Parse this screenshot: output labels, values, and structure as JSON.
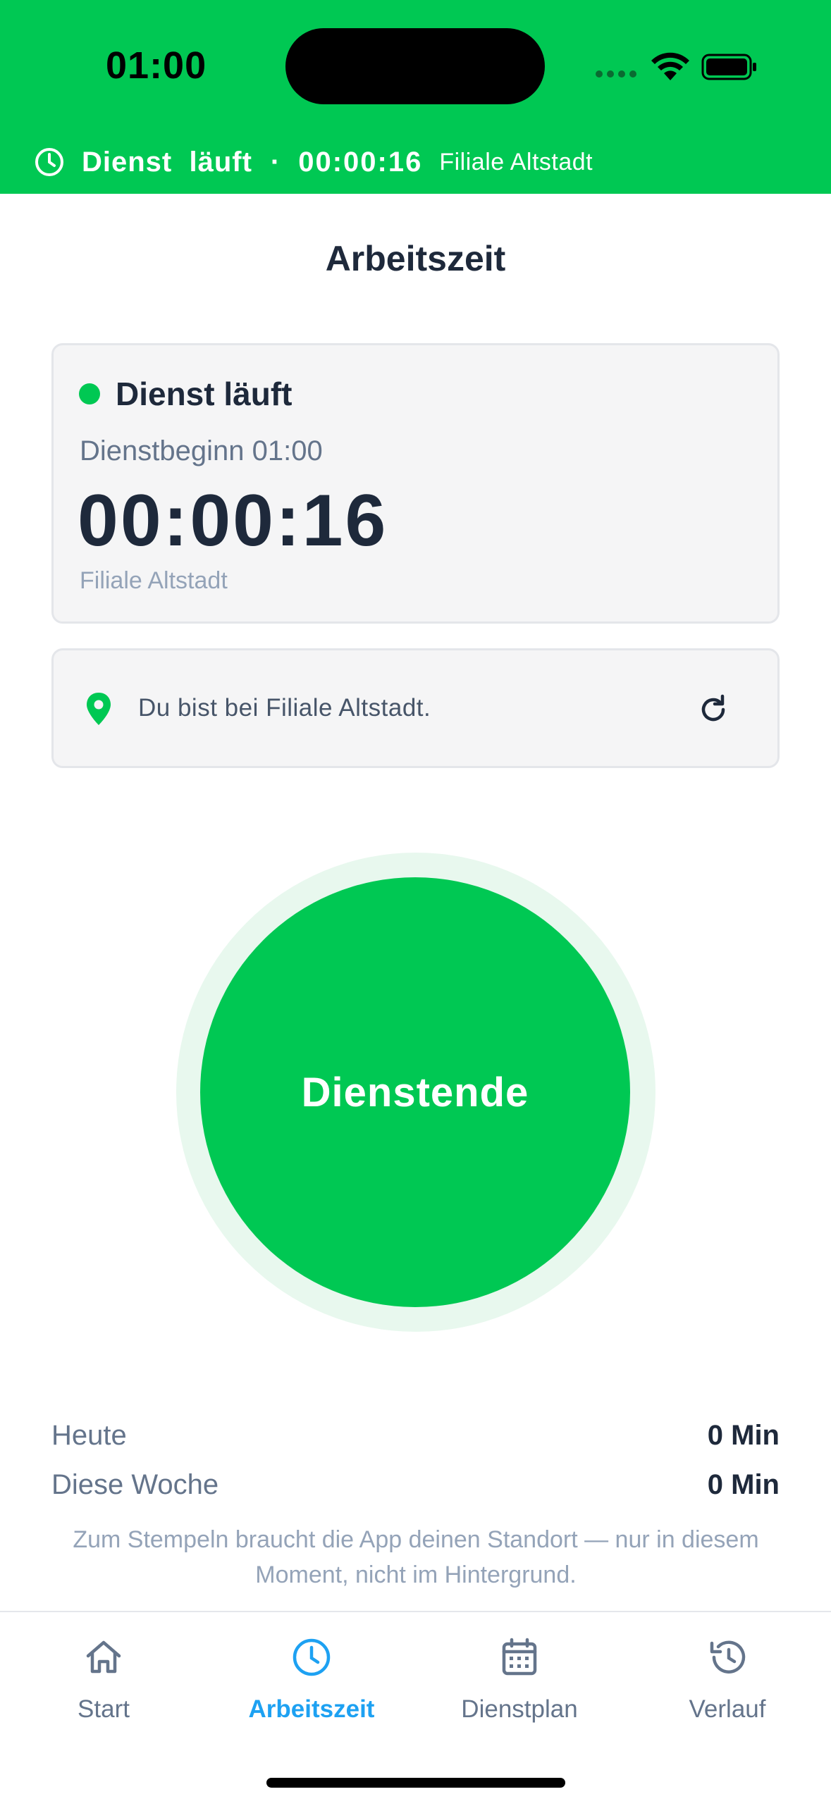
{
  "status_bar": {
    "time": "01:00"
  },
  "banner": {
    "status": "Dienst  läuft",
    "separator": "·",
    "timer": "00:00:16",
    "location": "Filiale Altstadt"
  },
  "page": {
    "title": "Arbeitszeit"
  },
  "shift_card": {
    "state": "Dienst läuft",
    "start_line": "Dienstbeginn 01:00",
    "timer": "00:00:16",
    "location": "Filiale Altstadt"
  },
  "location_card": {
    "message": "Du bist bei Filiale Altstadt."
  },
  "action": {
    "label": "Dienstende"
  },
  "summary": {
    "today_label": "Heute",
    "today_value": "0 Min",
    "week_label": "Diese Woche",
    "week_value": "0 Min",
    "hint": "Zum Stempeln braucht die App deinen Standort — nur in diesem Moment, nicht im Hintergrund."
  },
  "tabs": [
    {
      "label": "Start",
      "icon": "home-icon",
      "active": false
    },
    {
      "label": "Arbeitszeit",
      "icon": "clock-icon",
      "active": true
    },
    {
      "label": "Dienstplan",
      "icon": "calendar-icon",
      "active": false
    },
    {
      "label": "Verlauf",
      "icon": "history-icon",
      "active": false
    }
  ],
  "colors": {
    "accent_green": "#00c853",
    "active_tab_blue": "#1da1f2",
    "text_dark": "#1e293b",
    "text_muted": "#64748b"
  }
}
